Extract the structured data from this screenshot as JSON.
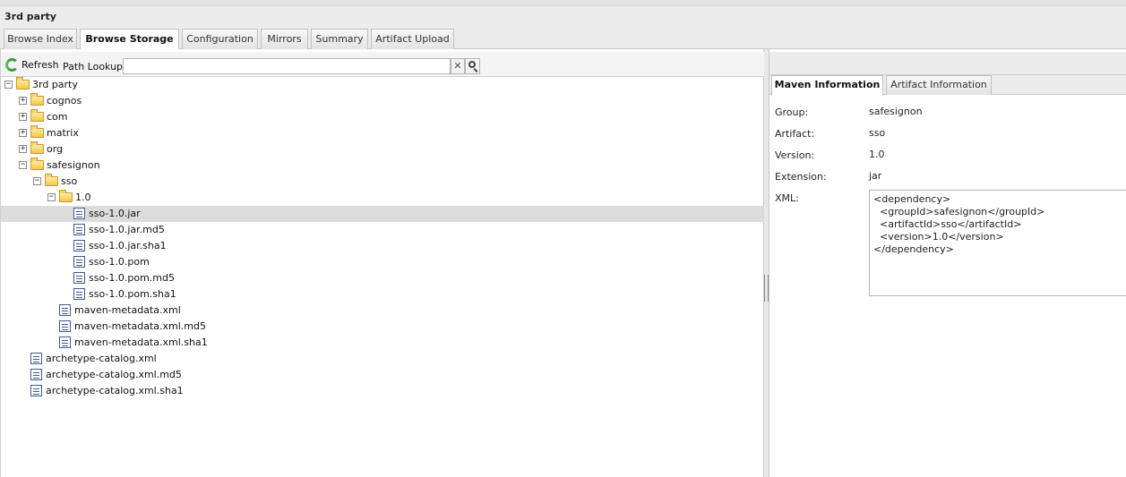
{
  "window": {
    "title": "3rd party"
  },
  "tabs": [
    {
      "label": "Browse Index",
      "active": false
    },
    {
      "label": "Browse Storage",
      "active": true
    },
    {
      "label": "Configuration",
      "active": false
    },
    {
      "label": "Mirrors",
      "active": false
    },
    {
      "label": "Summary",
      "active": false
    },
    {
      "label": "Artifact Upload",
      "active": false
    }
  ],
  "toolbar": {
    "refresh_label": "Refresh",
    "path_lookup_label": "Path Lookup:",
    "path_lookup_value": "",
    "clear_symbol": "✕"
  },
  "tree": [
    {
      "label": "3rd party",
      "type": "folder",
      "expanded": true,
      "depth": 0
    },
    {
      "label": "cognos",
      "type": "folder",
      "expanded": false,
      "depth": 1
    },
    {
      "label": "com",
      "type": "folder",
      "expanded": false,
      "depth": 1
    },
    {
      "label": "matrix",
      "type": "folder",
      "expanded": false,
      "depth": 1
    },
    {
      "label": "org",
      "type": "folder",
      "expanded": false,
      "depth": 1
    },
    {
      "label": "safesignon",
      "type": "folder",
      "expanded": true,
      "depth": 1
    },
    {
      "label": "sso",
      "type": "folder",
      "expanded": true,
      "depth": 2
    },
    {
      "label": "1.0",
      "type": "folder",
      "expanded": true,
      "depth": 3
    },
    {
      "label": "sso-1.0.jar",
      "type": "file",
      "depth": 4,
      "selected": true
    },
    {
      "label": "sso-1.0.jar.md5",
      "type": "file",
      "depth": 4
    },
    {
      "label": "sso-1.0.jar.sha1",
      "type": "file",
      "depth": 4
    },
    {
      "label": "sso-1.0.pom",
      "type": "file",
      "depth": 4
    },
    {
      "label": "sso-1.0.pom.md5",
      "type": "file",
      "depth": 4
    },
    {
      "label": "sso-1.0.pom.sha1",
      "type": "file",
      "depth": 4
    },
    {
      "label": "maven-metadata.xml",
      "type": "file",
      "depth": 3
    },
    {
      "label": "maven-metadata.xml.md5",
      "type": "file",
      "depth": 3
    },
    {
      "label": "maven-metadata.xml.sha1",
      "type": "file",
      "depth": 3
    },
    {
      "label": "archetype-catalog.xml",
      "type": "file",
      "depth": 1
    },
    {
      "label": "archetype-catalog.xml.md5",
      "type": "file",
      "depth": 1
    },
    {
      "label": "archetype-catalog.xml.sha1",
      "type": "file",
      "depth": 1
    }
  ],
  "details": {
    "tabs": [
      {
        "label": "Maven Information",
        "active": true
      },
      {
        "label": "Artifact Information",
        "active": false
      }
    ],
    "fields": [
      {
        "label": "Group:",
        "value": "safesignon"
      },
      {
        "label": "Artifact:",
        "value": "sso"
      },
      {
        "label": "Version:",
        "value": "1.0"
      },
      {
        "label": "Extension:",
        "value": "jar"
      }
    ],
    "xml_label": "XML:",
    "xml_value": "<dependency>\n  <groupId>safesignon</groupId>\n  <artifactId>sso</artifactId>\n  <version>1.0</version>\n</dependency>"
  }
}
